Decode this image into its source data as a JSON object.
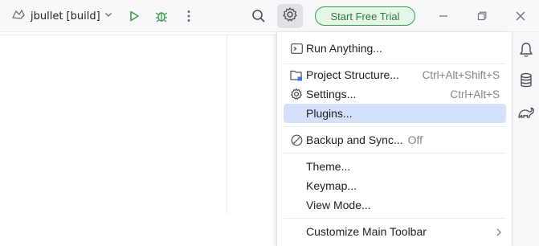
{
  "toolbar": {
    "run_config": "jbullet [build]",
    "trial_label": "Start Free Trial"
  },
  "menu": {
    "run_anything": "Run Anything...",
    "project_structure": "Project Structure...",
    "project_structure_shortcut": "Ctrl+Alt+Shift+S",
    "settings": "Settings...",
    "settings_shortcut": "Ctrl+Alt+S",
    "plugins": "Plugins...",
    "backup_sync": "Backup and Sync...",
    "backup_sync_status": "Off",
    "theme": "Theme...",
    "keymap": "Keymap...",
    "view_mode": "View Mode...",
    "customize_toolbar": "Customize Main Toolbar"
  },
  "colors": {
    "accent_green": "#3e9b4b",
    "selection": "#d5e1fb",
    "chrome": "#f7f8fa"
  },
  "icons": [
    "project-icon",
    "chevron-down-icon",
    "run-icon",
    "debug-icon",
    "more-vertical-icon",
    "search-icon",
    "gear-icon",
    "minimize-icon",
    "restore-icon",
    "close-icon",
    "notifications-icon",
    "database-icon",
    "gradle-icon",
    "run-anything-icon",
    "project-structure-icon",
    "settings-icon",
    "backup-sync-icon",
    "submenu-arrow-icon"
  ]
}
